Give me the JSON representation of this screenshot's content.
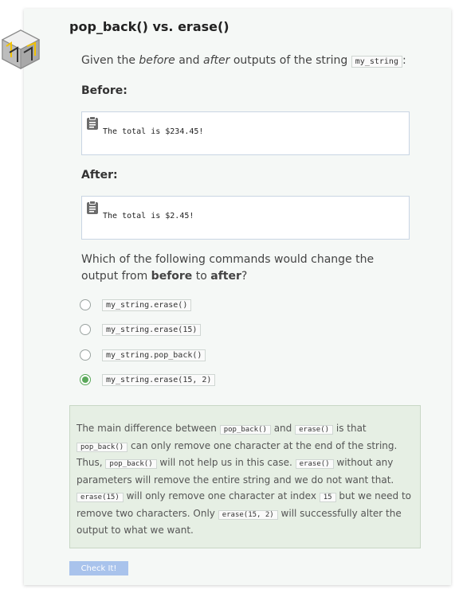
{
  "page": {
    "title": "pop_back() vs. erase()"
  },
  "prompt": {
    "pre": "Given the ",
    "em1": "before",
    "mid": " and ",
    "em2": "after",
    "post": " outputs of the string ",
    "code": "my_string",
    "end": ":"
  },
  "before": {
    "label": "Before:",
    "output": "The total is $234.45!"
  },
  "after": {
    "label": "After:",
    "output": "The total is $2.45!"
  },
  "question": {
    "pre": "Which of the following commands would change the output from ",
    "bold1": "before",
    "mid": " to ",
    "bold2": "after",
    "end": "?"
  },
  "options": [
    {
      "label": "my_string.erase()",
      "selected": false
    },
    {
      "label": "my_string.erase(15)",
      "selected": false
    },
    {
      "label": "my_string.pop_back()",
      "selected": false
    },
    {
      "label": "my_string.erase(15, 2)",
      "selected": true
    }
  ],
  "feedback": {
    "t1": "The main difference between ",
    "c1": "pop_back()",
    "t2": " and ",
    "c2": "erase()",
    "t3": " is that ",
    "c3": "pop_back()",
    "t4": " can only remove one character at the end of the string. Thus, ",
    "c4": "pop_back()",
    "t5": " will not help us in this case. ",
    "c5": "erase()",
    "t6": " without any parameters will remove the entire string and we do not want that. ",
    "c6": "erase(15)",
    "t7": " will only remove one character at index ",
    "c7": "15",
    "t8": " but we need to remove two characters. Only ",
    "c8": "erase(15, 2)",
    "t9": " will successfully alter the output to what we want."
  },
  "actions": {
    "check_label": "Check It!"
  },
  "colors": {
    "accent_success": "#5aa85a",
    "button": "#a9c3ec",
    "feedback_bg": "#e6efe4"
  },
  "icons": {
    "badge": "challenge-cube-icon",
    "output": "clipboard-icon"
  }
}
